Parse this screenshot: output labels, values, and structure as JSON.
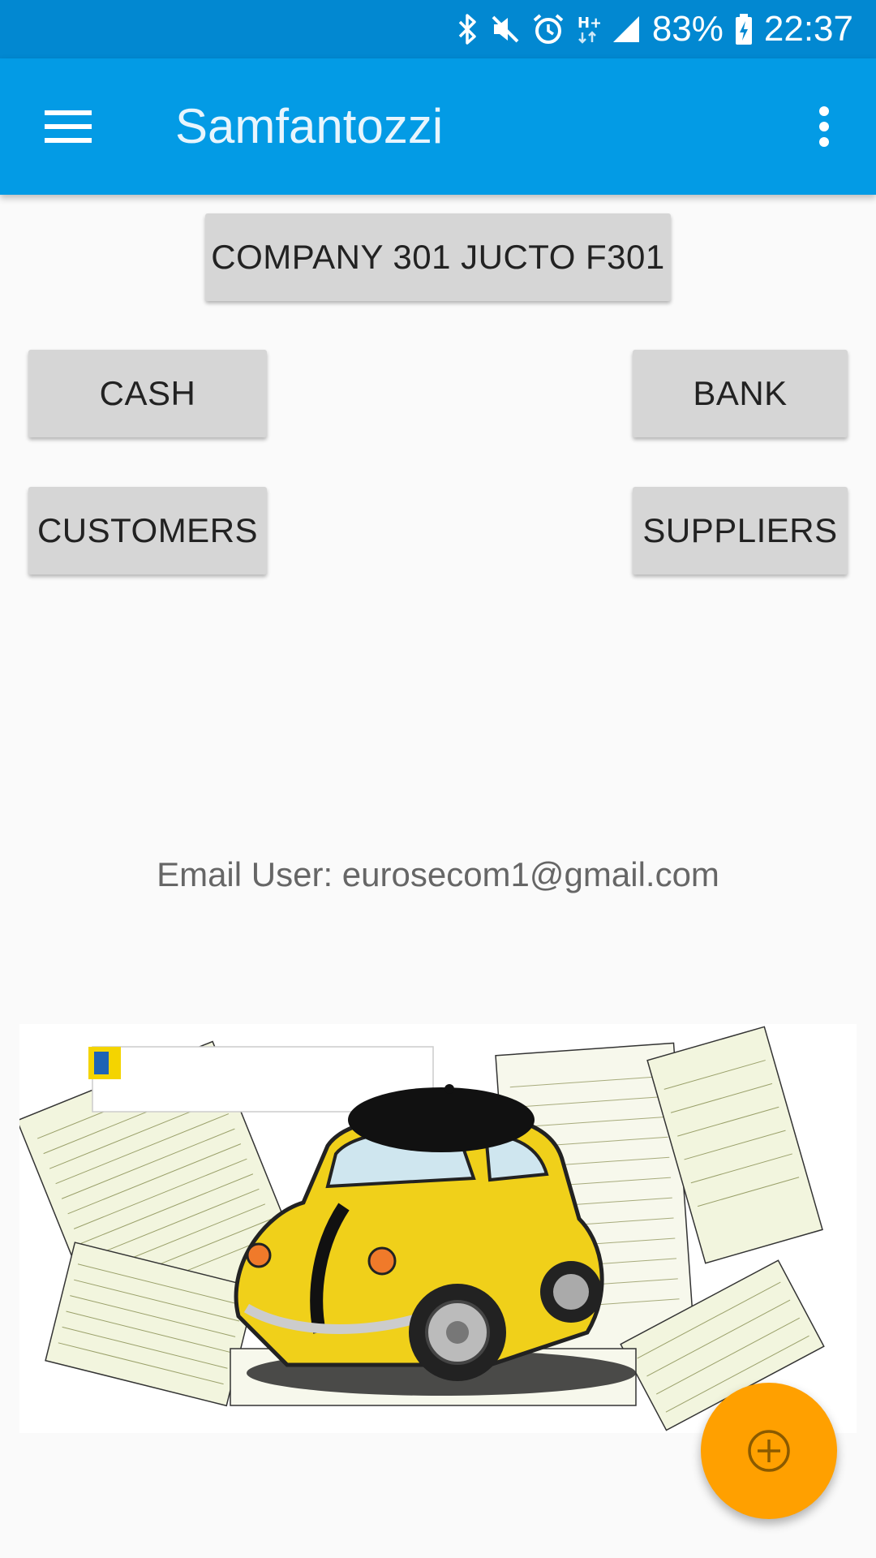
{
  "status_bar": {
    "battery": "83%",
    "time": "22:37",
    "icons": [
      "bluetooth-icon",
      "mute-icon",
      "alarm-icon",
      "hplus-data-icon",
      "signal-icon",
      "battery-charging-icon"
    ]
  },
  "app_bar": {
    "title": "Samfantozzi",
    "menu_icon": "hamburger-menu-icon",
    "overflow_icon": "more-vert-icon",
    "background": "#039be5"
  },
  "buttons": {
    "company": "COMPANY 301 JUCTO F301",
    "cash": "CASH",
    "bank": "BANK",
    "customers": "CUSTOMERS",
    "suppliers": "SUPPLIERS"
  },
  "email": {
    "label": "Email User: eurosecom1@gmail.com"
  },
  "banner": {
    "icon": "yellow-car-with-tax-forms-illustration"
  },
  "fab": {
    "icon": "add-circle-icon",
    "color": "#ffa000"
  }
}
